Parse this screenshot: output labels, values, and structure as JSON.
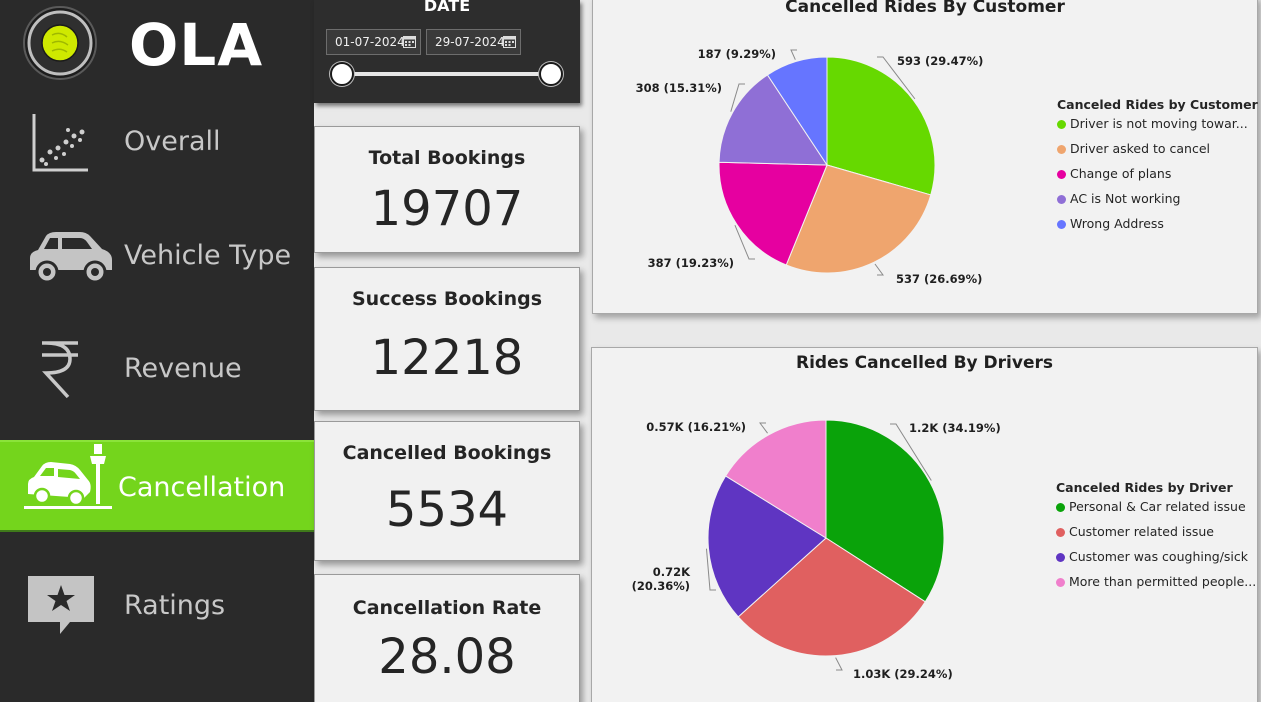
{
  "app": {
    "logo_text": "OLA"
  },
  "nav": {
    "items": [
      {
        "label": "Overall",
        "icon": "scatter-chart-icon"
      },
      {
        "label": "Vehicle Type",
        "icon": "car-icon"
      },
      {
        "label": "Revenue",
        "icon": "rupee-icon"
      },
      {
        "label": "Cancellation",
        "icon": "car-crash-icon",
        "active": true
      },
      {
        "label": "Ratings",
        "icon": "star-message-icon"
      }
    ],
    "active_color": "#74d51c"
  },
  "slicer": {
    "title": "DATE",
    "start_date": "01-07-2024",
    "end_date": "29-07-2024"
  },
  "kpis": [
    {
      "title": "Total Bookings",
      "value": "19707"
    },
    {
      "title": "Success Bookings",
      "value": "12218"
    },
    {
      "title": "Cancelled Bookings",
      "value": "5534"
    },
    {
      "title": "Cancellation Rate",
      "value": "28.08"
    }
  ],
  "chart_data": [
    {
      "type": "pie",
      "title": "Cancelled Rides By Customer",
      "legend_title": "Canceled Rides by Customer",
      "legend_position": "right",
      "slices": [
        {
          "name": "Driver is not moving towar...",
          "value": 593,
          "label": "593 (29.47%)",
          "color": "#66d900"
        },
        {
          "name": "Driver asked to cancel",
          "value": 537,
          "label": "537 (26.69%)",
          "color": "#efa56e"
        },
        {
          "name": "Change of plans",
          "value": 387,
          "label": "387 (19.23%)",
          "color": "#e600a0"
        },
        {
          "name": "AC is Not working",
          "value": 308,
          "label": "308 (15.31%)",
          "color": "#8f6fd6"
        },
        {
          "name": "Wrong Address",
          "value": 187,
          "label": "187 (9.29%)",
          "color": "#6675ff"
        }
      ]
    },
    {
      "type": "pie",
      "title": "Rides Cancelled By Drivers",
      "legend_title": "Canceled Rides by Driver",
      "legend_position": "right",
      "slices": [
        {
          "name": "Personal & Car related issue",
          "value": 1200,
          "label": "1.2K (34.19%)",
          "color": "#0aa30a"
        },
        {
          "name": "Customer related issue",
          "value": 1030,
          "label": "1.03K (29.24%)",
          "color": "#e06060"
        },
        {
          "name": "Customer was coughing/sick",
          "value": 720,
          "label": "0.72K\n(20.36%)",
          "color": "#5f35c2"
        },
        {
          "name": "More than permitted people...",
          "value": 570,
          "label": "0.57K (16.21%)",
          "color": "#f07fcc"
        }
      ]
    }
  ]
}
